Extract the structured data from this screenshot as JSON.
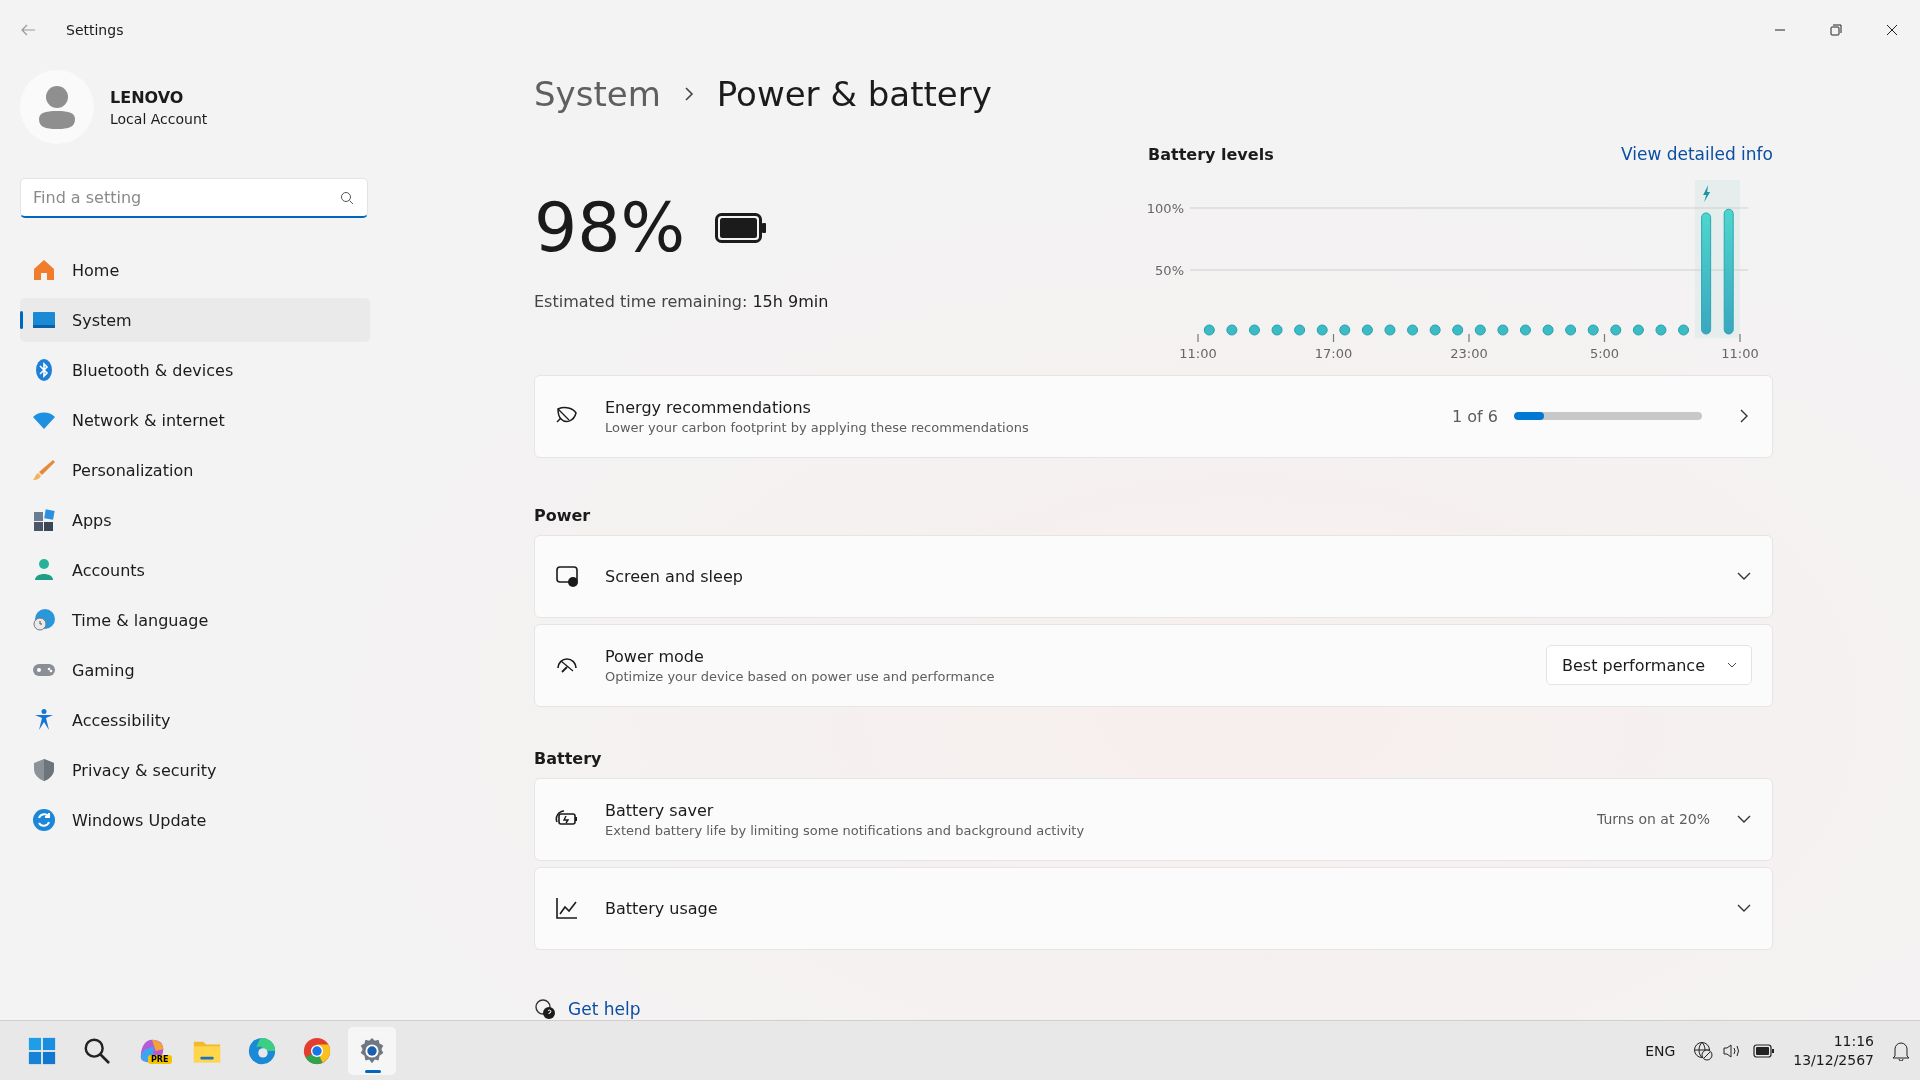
{
  "window": {
    "title": "Settings"
  },
  "account": {
    "name": "LENOVO",
    "type": "Local Account"
  },
  "search": {
    "placeholder": "Find a setting"
  },
  "nav": [
    {
      "label": "Home",
      "selected": false
    },
    {
      "label": "System",
      "selected": true
    },
    {
      "label": "Bluetooth & devices",
      "selected": false
    },
    {
      "label": "Network & internet",
      "selected": false
    },
    {
      "label": "Personalization",
      "selected": false
    },
    {
      "label": "Apps",
      "selected": false
    },
    {
      "label": "Accounts",
      "selected": false
    },
    {
      "label": "Time & language",
      "selected": false
    },
    {
      "label": "Gaming",
      "selected": false
    },
    {
      "label": "Accessibility",
      "selected": false
    },
    {
      "label": "Privacy & security",
      "selected": false
    },
    {
      "label": "Windows Update",
      "selected": false
    }
  ],
  "breadcrumb": [
    "System",
    "Power & battery"
  ],
  "battery": {
    "percent": "98%",
    "level": 0.98,
    "remaining_label": "Estimated time remaining:",
    "remaining": "15h 9min"
  },
  "battery_levels": {
    "title": "Battery levels",
    "link": "View detailed info",
    "chart_data": {
      "type": "bar",
      "ylim": [
        0,
        100
      ],
      "yticks": [
        {
          "value": 50,
          "label": "50%"
        },
        {
          "value": 100,
          "label": "100%"
        }
      ],
      "categories": [
        "11:00",
        null,
        null,
        null,
        null,
        null,
        "17:00",
        null,
        null,
        null,
        null,
        null,
        "23:00",
        null,
        null,
        null,
        null,
        null,
        "5:00",
        null,
        null,
        null,
        null,
        "11:00"
      ],
      "values": [
        null,
        null,
        null,
        null,
        null,
        null,
        null,
        null,
        null,
        null,
        null,
        null,
        null,
        null,
        null,
        null,
        null,
        null,
        null,
        null,
        null,
        null,
        96,
        99
      ]
    }
  },
  "recommendations": {
    "title": "Energy recommendations",
    "subtitle": "Lower your carbon footprint by applying these recommendations",
    "count": "1 of 6",
    "level": 0.16
  },
  "sections": [
    {
      "heading": "Power",
      "items": [
        {
          "kind": "expander",
          "title": "Screen and sleep"
        },
        {
          "kind": "dropdown",
          "title": "Power mode",
          "subtitle": "Optimize your device based on power use and performance",
          "value": "Best performance"
        }
      ]
    },
    {
      "heading": "Battery",
      "items": [
        {
          "kind": "expander",
          "title": "Battery saver",
          "subtitle": "Extend battery life by limiting some notifications and background activity",
          "value": "Turns on at 20%"
        },
        {
          "kind": "expander",
          "title": "Battery usage"
        }
      ]
    }
  ],
  "help": {
    "label": "Get help"
  },
  "taskbar": {
    "apps": [
      {
        "selected": false
      },
      {
        "selected": false
      },
      {
        "badge": "PRE",
        "selected": false
      },
      {
        "selected": false
      },
      {
        "selected": false
      },
      {
        "selected": false
      },
      {
        "selected": true
      }
    ],
    "language": "ENG",
    "time": "11:16",
    "date": "13/12/2567"
  }
}
